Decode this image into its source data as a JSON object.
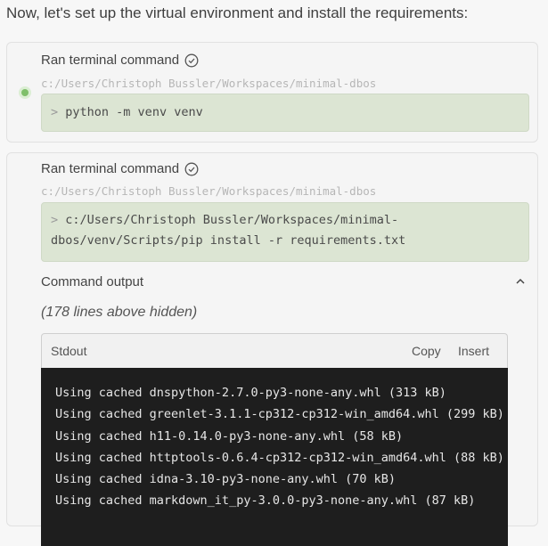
{
  "intro_text": "Now, let's set up the virtual environment and install the requirements:",
  "cards": [
    {
      "title": "Ran terminal command",
      "path": "c:/Users/Christoph Bussler/Workspaces/minimal-dbos",
      "prompt": ">",
      "command_lines": [
        "python -m venv venv"
      ]
    },
    {
      "title": "Ran terminal command",
      "path": "c:/Users/Christoph Bussler/Workspaces/minimal-dbos",
      "prompt": ">",
      "command_lines": [
        "c:/Users/Christoph Bussler/Workspaces/minimal-",
        "dbos/venv/Scripts/pip install -r requirements.txt"
      ],
      "output": {
        "label": "Command output",
        "hidden_note": "(178 lines above hidden)",
        "stream_label": "Stdout",
        "copy_label": "Copy",
        "insert_label": "Insert",
        "lines": [
          "Using cached dnspython-2.7.0-py3-none-any.whl (313 kB)",
          "Using cached greenlet-3.1.1-cp312-cp312-win_amd64.whl (299 kB)",
          "Using cached h11-0.14.0-py3-none-any.whl (58 kB)",
          "Using cached httptools-0.6.4-cp312-cp312-win_amd64.whl (88 kB)",
          "Using cached idna-3.10-py3-none-any.whl (70 kB)",
          "Using cached markdown_it_py-3.0.0-py3-none-any.whl (87 kB)"
        ]
      }
    }
  ],
  "colors": {
    "status_dot": "#7fbf6a",
    "command_bg": "#dce5d3",
    "terminal_bg": "#1e1e1e"
  }
}
